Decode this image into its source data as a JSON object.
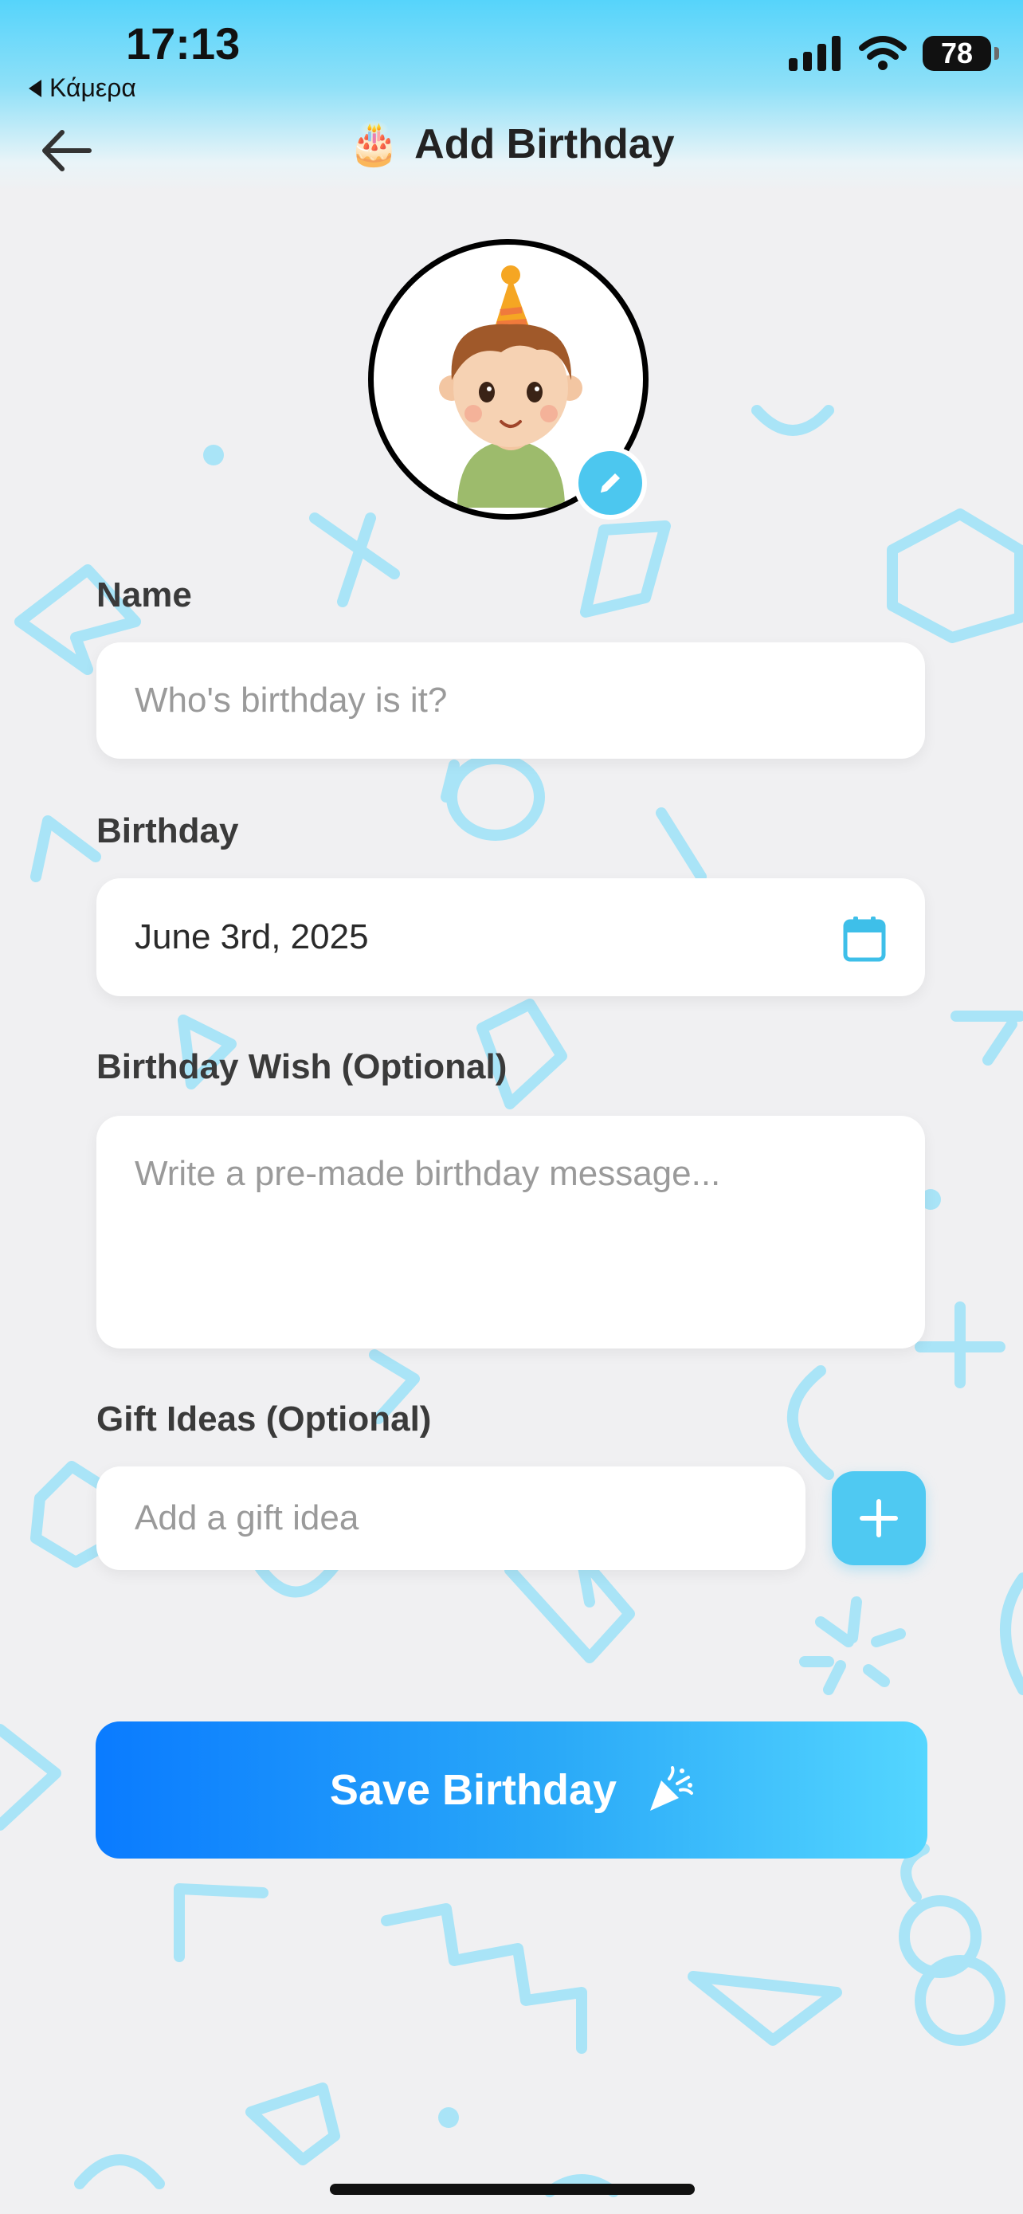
{
  "status_bar": {
    "time": "17:13",
    "back_app": "Κάμερα",
    "battery": "78"
  },
  "nav": {
    "title_emoji": "🎂",
    "title": "Add Birthday"
  },
  "form": {
    "name_label": "Name",
    "name_placeholder": "Who's birthday is it?",
    "birthday_label": "Birthday",
    "birthday_value": "June 3rd, 2025",
    "wish_label": "Birthday Wish (Optional)",
    "wish_placeholder": "Write a pre-made birthday message...",
    "gift_label": "Gift Ideas (Optional)",
    "gift_placeholder": "Add a gift idea"
  },
  "save_button": {
    "label": "Save Birthday"
  },
  "icons": {
    "back": "arrow-left-icon",
    "edit": "pencil-icon",
    "calendar": "calendar-icon",
    "add": "plus-icon",
    "party": "party-popper-icon"
  },
  "colors": {
    "accent": "#4fc9f2",
    "button_start": "#0a7bff",
    "button_end": "#54d6ff",
    "deco": "#a9e4f7"
  }
}
